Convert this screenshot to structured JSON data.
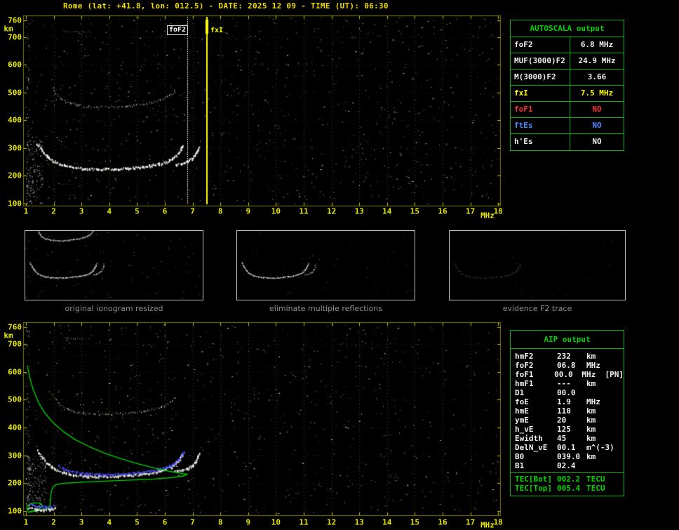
{
  "title": "Rome (lat: +41.8, lon: 012.5) - DATE: 2025 12 09 - TIME (UT): 06:30",
  "colors": {
    "background": "#000000",
    "title_yellow": "#f2de00",
    "axis_yellow": "#e8e800",
    "frame_olive": "#7f7f00",
    "table_green": "#00b400",
    "header_green": "#00d400",
    "profile_green": "#00d800",
    "trace_blue": "#5050ff",
    "status_red": "#ff3232",
    "status_blue": "#4f8cff",
    "marker_white": "#ffffff",
    "marker_yellow": "#ffff00"
  },
  "ionogram_axes": {
    "xticks": [
      "1",
      "2",
      "3",
      "4",
      "5",
      "6",
      "7",
      "8",
      "9",
      "10",
      "11",
      "12",
      "13",
      "14",
      "15",
      "16",
      "17",
      "18"
    ],
    "yticks": [
      "760",
      "700",
      "600",
      "500",
      "400",
      "300",
      "200",
      "100"
    ],
    "xunit": "MHz",
    "yunit": "km"
  },
  "autoscala_table": {
    "header": "AUTOSCALA output",
    "rows": [
      {
        "label": "foF2",
        "value": "6.8 MHz",
        "color": "#f0f0f0"
      },
      {
        "label": "MUF(3000)F2",
        "value": "24.9 MHz",
        "color": "#f0f0f0"
      },
      {
        "label": "M(3000)F2",
        "value": "3.66",
        "color": "#f0f0f0"
      },
      {
        "label": "fxI",
        "value": "7.5 MHz",
        "color": "#ffff00"
      },
      {
        "label": "foF1",
        "value": "NO",
        "color": "#ff3232"
      },
      {
        "label": "ftEs",
        "value": "NO",
        "color": "#4f8cff"
      },
      {
        "label": "h'Es",
        "value": "NO",
        "color": "#f0f0f0"
      }
    ]
  },
  "aip_table": {
    "header": "AIP output",
    "rows": [
      {
        "label": "hmF2",
        "value": "232",
        "unit": "km",
        "color": "#f0f0f0"
      },
      {
        "label": "foF2",
        "value": "06.8",
        "unit": "MHz",
        "color": "#f0f0f0"
      },
      {
        "label": "foF1",
        "value": "00.0",
        "unit": "MHz  [PN]",
        "color": "#f0f0f0"
      },
      {
        "label": "hmF1",
        "value": "---",
        "unit": "km",
        "color": "#f0f0f0"
      },
      {
        "label": "D1",
        "value": "00.0",
        "unit": "",
        "color": "#f0f0f0"
      },
      {
        "label": "foE",
        "value": "1.9",
        "unit": "MHz",
        "color": "#f0f0f0"
      },
      {
        "label": "hmE",
        "value": "110",
        "unit": "km",
        "color": "#f0f0f0"
      },
      {
        "label": "ymE",
        "value": "20",
        "unit": "km",
        "color": "#f0f0f0"
      },
      {
        "label": "h_vE",
        "value": "125",
        "unit": "km",
        "color": "#f0f0f0"
      },
      {
        "label": "Ewidth",
        "value": "45",
        "unit": "km",
        "color": "#f0f0f0"
      },
      {
        "label": "DelN_vE",
        "value": "00.1",
        "unit": "m^(-3)",
        "color": "#f0f0f0"
      },
      {
        "label": "B0",
        "value": "039.0",
        "unit": "km",
        "color": "#f0f0f0"
      },
      {
        "label": "B1",
        "value": "02.4",
        "unit": "",
        "color": "#f0f0f0"
      },
      {
        "label": "TEC[Bot]",
        "value": "002.2",
        "unit": "TECU",
        "color": "#00d400"
      },
      {
        "label": "TEC[Top]",
        "value": "005.4",
        "unit": "TECU",
        "color": "#00d400"
      }
    ]
  },
  "thumbnails": [
    {
      "caption": "original ionogram resized"
    },
    {
      "caption": "eliminate multiple reflections"
    },
    {
      "caption": "evidence F2 trace"
    }
  ],
  "chart_data": {
    "type": "scatter",
    "description": "Vertical incidence ionogram: echo virtual height (km) vs sounding frequency (MHz). Same echo traces appear in top (AUTOSCALA) and bottom (AIP) panels; bottom panel adds restored trace and electron density profile.",
    "xlabel": "MHz",
    "ylabel": "km",
    "xlim": [
      1,
      18
    ],
    "ylim": [
      100,
      760
    ],
    "grid": "dotted",
    "series": [
      {
        "name": "F2 trace 1st hop o-mode",
        "style": "white-bright",
        "points": [
          [
            1.4,
            318
          ],
          [
            1.6,
            290
          ],
          [
            1.8,
            268
          ],
          [
            2.05,
            250
          ],
          [
            2.35,
            239
          ],
          [
            2.7,
            232
          ],
          [
            3.1,
            228
          ],
          [
            3.5,
            226
          ],
          [
            3.9,
            226
          ],
          [
            4.3,
            227
          ],
          [
            4.7,
            230
          ],
          [
            5.1,
            233
          ],
          [
            5.45,
            238
          ],
          [
            5.75,
            244
          ],
          [
            6.0,
            251
          ],
          [
            6.2,
            260
          ],
          [
            6.35,
            271
          ],
          [
            6.47,
            284
          ],
          [
            6.56,
            297
          ],
          [
            6.63,
            312
          ]
        ]
      },
      {
        "name": "F2 trace 1st hop x-mode",
        "style": "white-bright",
        "points": [
          [
            6.35,
            243
          ],
          [
            6.6,
            248
          ],
          [
            6.8,
            255
          ],
          [
            6.97,
            265
          ],
          [
            7.08,
            278
          ],
          [
            7.15,
            292
          ],
          [
            7.2,
            308
          ]
        ]
      },
      {
        "name": "F2 trace 2nd hop",
        "style": "white-dim",
        "points": [
          [
            1.95,
            520
          ],
          [
            2.08,
            500
          ],
          [
            2.22,
            483
          ],
          [
            2.4,
            470
          ],
          [
            2.62,
            461
          ],
          [
            2.9,
            455
          ],
          [
            3.25,
            451
          ],
          [
            3.65,
            449
          ],
          [
            4.05,
            449
          ],
          [
            4.45,
            451
          ],
          [
            4.85,
            455
          ],
          [
            5.25,
            460
          ],
          [
            5.6,
            467
          ],
          [
            5.9,
            476
          ],
          [
            6.1,
            486
          ],
          [
            6.25,
            497
          ],
          [
            6.37,
            509
          ]
        ]
      },
      {
        "name": "faint 3rd hop echo",
        "style": "white-faint",
        "points": [
          [
            2.35,
            722
          ],
          [
            2.7,
            721
          ],
          [
            3.05,
            720
          ],
          [
            3.35,
            719
          ]
        ]
      }
    ],
    "bottom_overlays": [
      {
        "name": "restored F2 trace",
        "style": "blue",
        "points": [
          [
            2.15,
            265
          ],
          [
            2.45,
            250
          ],
          [
            2.8,
            241
          ],
          [
            3.2,
            236
          ],
          [
            3.65,
            234
          ],
          [
            4.1,
            234
          ],
          [
            4.55,
            236
          ],
          [
            5.0,
            240
          ],
          [
            5.4,
            245
          ],
          [
            5.75,
            251
          ],
          [
            6.05,
            259
          ],
          [
            6.28,
            270
          ],
          [
            6.45,
            283
          ],
          [
            6.57,
            297
          ],
          [
            6.65,
            312
          ]
        ]
      },
      {
        "name": "electron density profile",
        "style": "green-line",
        "points": [
          [
            1.05,
            622
          ],
          [
            1.14,
            578
          ],
          [
            1.27,
            533
          ],
          [
            1.45,
            490
          ],
          [
            1.68,
            452
          ],
          [
            1.98,
            417
          ],
          [
            2.35,
            385
          ],
          [
            2.78,
            356
          ],
          [
            3.3,
            330
          ],
          [
            3.85,
            307
          ],
          [
            4.45,
            287
          ],
          [
            5.05,
            269
          ],
          [
            5.65,
            254
          ],
          [
            6.15,
            243
          ],
          [
            6.55,
            236
          ],
          [
            6.8,
            232
          ],
          [
            6.68,
            226
          ],
          [
            6.25,
            220
          ],
          [
            5.6,
            215
          ],
          [
            4.8,
            211
          ],
          [
            4.0,
            208
          ],
          [
            3.3,
            205
          ],
          [
            2.7,
            202
          ],
          [
            2.3,
            199
          ],
          [
            2.08,
            194
          ],
          [
            1.98,
            187
          ],
          [
            1.93,
            176
          ],
          [
            1.9,
            162
          ],
          [
            1.89,
            148
          ],
          [
            1.88,
            134
          ],
          [
            1.86,
            120
          ],
          [
            1.78,
            111
          ],
          [
            1.62,
            105
          ],
          [
            1.42,
            101
          ],
          [
            1.22,
            98
          ],
          [
            1.08,
            96
          ]
        ]
      },
      {
        "name": "E-valley loop",
        "style": "green-line",
        "points": [
          [
            1.08,
            96
          ],
          [
            1.3,
            101
          ],
          [
            1.52,
            110
          ],
          [
            1.6,
            120
          ],
          [
            1.5,
            128
          ],
          [
            1.32,
            130
          ],
          [
            1.15,
            126
          ],
          [
            1.05,
            117
          ],
          [
            1.05,
            106
          ],
          [
            1.08,
            96
          ]
        ]
      },
      {
        "name": "E-region echoes blue",
        "style": "blue",
        "points": [
          [
            1.12,
            128
          ],
          [
            1.3,
            122
          ],
          [
            1.5,
            118
          ],
          [
            1.68,
            116
          ],
          [
            1.85,
            118
          ],
          [
            2.0,
            122
          ]
        ]
      },
      {
        "name": "E-region echoes white",
        "style": "white-bright",
        "points": [
          [
            1.1,
            112
          ],
          [
            1.35,
            108
          ],
          [
            1.6,
            106
          ],
          [
            1.85,
            108
          ],
          [
            2.05,
            112
          ]
        ]
      }
    ],
    "markers": [
      {
        "name": "foF2",
        "label": "foF2",
        "freq_mhz": 6.8,
        "color": "#ffffff"
      },
      {
        "name": "fxI",
        "label": "fxI",
        "freq_mhz": 7.5,
        "color": "#ffff00"
      }
    ]
  }
}
